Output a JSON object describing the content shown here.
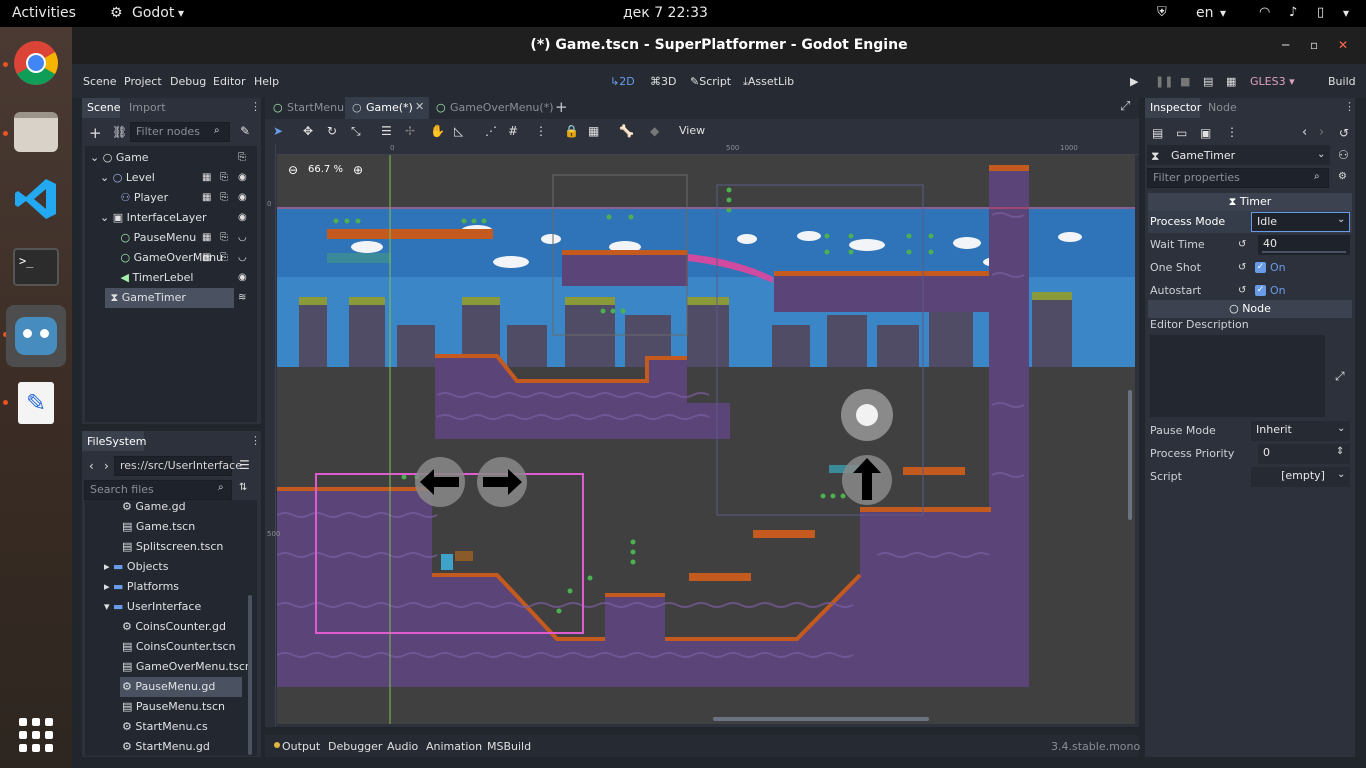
{
  "topbar": {
    "activities": "Activities",
    "app": "Godot",
    "app_arrow": "▾",
    "datetime": "дек 7  22:33",
    "lang": "en",
    "lang_arrow": "▾"
  },
  "dock": {
    "apps": [
      "chrome-icon",
      "files-icon",
      "vscode-icon",
      "terminal-icon",
      "godot-icon",
      "text-editor-icon",
      "app-grid-icon"
    ]
  },
  "window": {
    "title": "(*) Game.tscn - SuperPlatformer - Godot Engine"
  },
  "menu": {
    "items": [
      "Scene",
      "Project",
      "Debug",
      "Editor",
      "Help"
    ]
  },
  "workspace": {
    "twod": "2D",
    "threed": "3D",
    "script": "Script",
    "assetlib": "AssetLib"
  },
  "run": {
    "renderer": "GLES3",
    "renderer_arrow": "▾",
    "build": "Build"
  },
  "scene_dock": {
    "tabs": [
      "Scene",
      "Import"
    ],
    "filter_placeholder": "Filter nodes",
    "nodes": [
      {
        "name": "Game",
        "icon": "○",
        "color": "#e0e0e0"
      },
      {
        "name": "Level",
        "icon": "○",
        "color": "#a5b7f3"
      },
      {
        "name": "Player",
        "icon": "⚇",
        "color": "#a5b7f3"
      },
      {
        "name": "InterfaceLayer",
        "icon": "▣",
        "color": "#e0e0e0"
      },
      {
        "name": "PauseMenu",
        "icon": "○",
        "color": "#a5efac"
      },
      {
        "name": "GameOverMenu",
        "icon": "○",
        "color": "#a5efac"
      },
      {
        "name": "TimerLebel",
        "icon": "◀",
        "color": "#a5efac"
      },
      {
        "name": "GameTimer",
        "icon": "⧗",
        "color": "#e0e0e0"
      }
    ]
  },
  "filesystem": {
    "title": "FileSystem",
    "path": "res://src/UserInterface",
    "search_placeholder": "Search files",
    "items": [
      {
        "name": "Game.gd",
        "icon": "⚙",
        "folder": false
      },
      {
        "name": "Game.tscn",
        "icon": "🎬",
        "folder": false
      },
      {
        "name": "Splitscreen.tscn",
        "icon": "🎬",
        "folder": false
      },
      {
        "name": "Objects",
        "icon": "▸",
        "folder": true
      },
      {
        "name": "Platforms",
        "icon": "▸",
        "folder": true
      },
      {
        "name": "UserInterface",
        "icon": "▾",
        "folder": true
      },
      {
        "name": "CoinsCounter.gd",
        "icon": "⚙",
        "folder": false
      },
      {
        "name": "CoinsCounter.tscn",
        "icon": "🎬",
        "folder": false
      },
      {
        "name": "GameOverMenu.tscn",
        "icon": "🎬",
        "folder": false
      },
      {
        "name": "PauseMenu.gd",
        "icon": "⚙",
        "folder": false
      },
      {
        "name": "PauseMenu.tscn",
        "icon": "🎬",
        "folder": false
      },
      {
        "name": "StartMenu.cs",
        "icon": "⚙",
        "folder": false
      },
      {
        "name": "StartMenu.gd",
        "icon": "⚙",
        "folder": false
      }
    ]
  },
  "scene_tabs": [
    "StartMenu",
    "Game(*)",
    "GameOverMenu(*)"
  ],
  "canvas": {
    "zoom": "66.7 %",
    "view": "View",
    "ruler": [
      "0",
      "500",
      "1000"
    ],
    "ruler_v": [
      "0",
      "500"
    ]
  },
  "bottom_panel": {
    "tabs": [
      "Output",
      "Debugger",
      "Audio",
      "Animation",
      "MSBuild"
    ],
    "version": "3.4.stable.mono"
  },
  "inspector": {
    "tabs": [
      "Inspector",
      "Node"
    ],
    "object": "GameTimer",
    "filter_placeholder": "Filter properties",
    "section_timer": "Timer",
    "process_mode_label": "Process Mode",
    "process_mode": "Idle",
    "wait_time_label": "Wait Time",
    "wait_time": "40",
    "one_shot_label": "One Shot",
    "one_shot": "On",
    "autostart_label": "Autostart",
    "autostart": "On",
    "section_node": "Node",
    "editor_description_label": "Editor Description",
    "pause_mode_label": "Pause Mode",
    "pause_mode": "Inherit",
    "process_priority_label": "Process Priority",
    "process_priority": "0",
    "script_label": "Script",
    "script": "[empty]"
  },
  "colors": {
    "accent": "#699ce8",
    "selection": "#4a5261",
    "canvas_bg": "#404040",
    "sky": "#3a86c6",
    "ground": "#5a4478"
  }
}
